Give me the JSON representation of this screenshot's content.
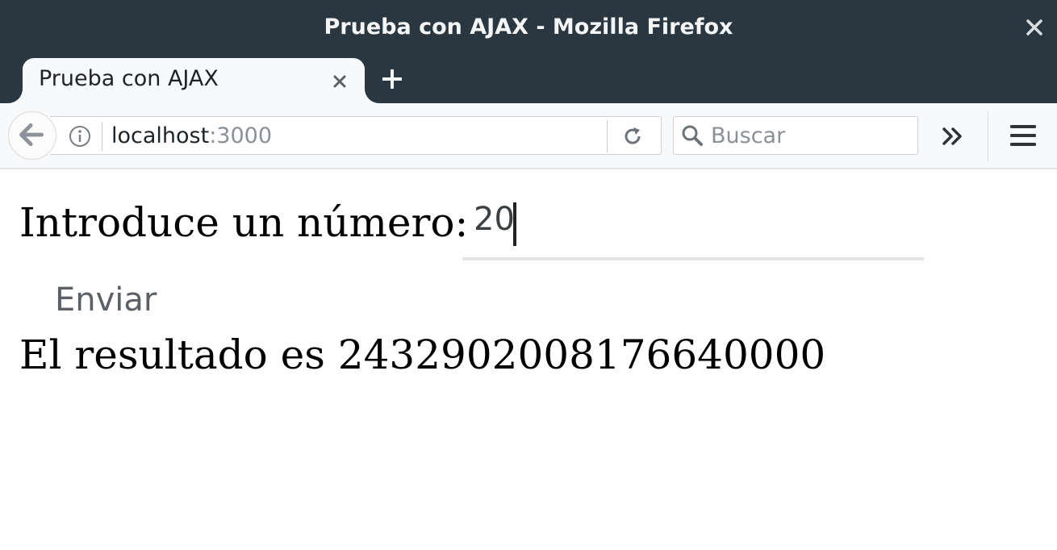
{
  "window": {
    "title": "Prueba con AJAX - Mozilla Firefox",
    "close_icon": "close-icon"
  },
  "tabs": [
    {
      "label": "Prueba con AJAX",
      "active": true
    }
  ],
  "navbar": {
    "url_host": "localhost",
    "url_port": ":3000",
    "search_placeholder": "Buscar"
  },
  "page": {
    "prompt_label": "Introduce un número:",
    "number_value": "20",
    "submit_label": "Enviar",
    "result_text": "El resultado es 2432902008176640000"
  },
  "colors": {
    "titlebar": "#2b3740",
    "toolbar": "#f8f9fa"
  }
}
